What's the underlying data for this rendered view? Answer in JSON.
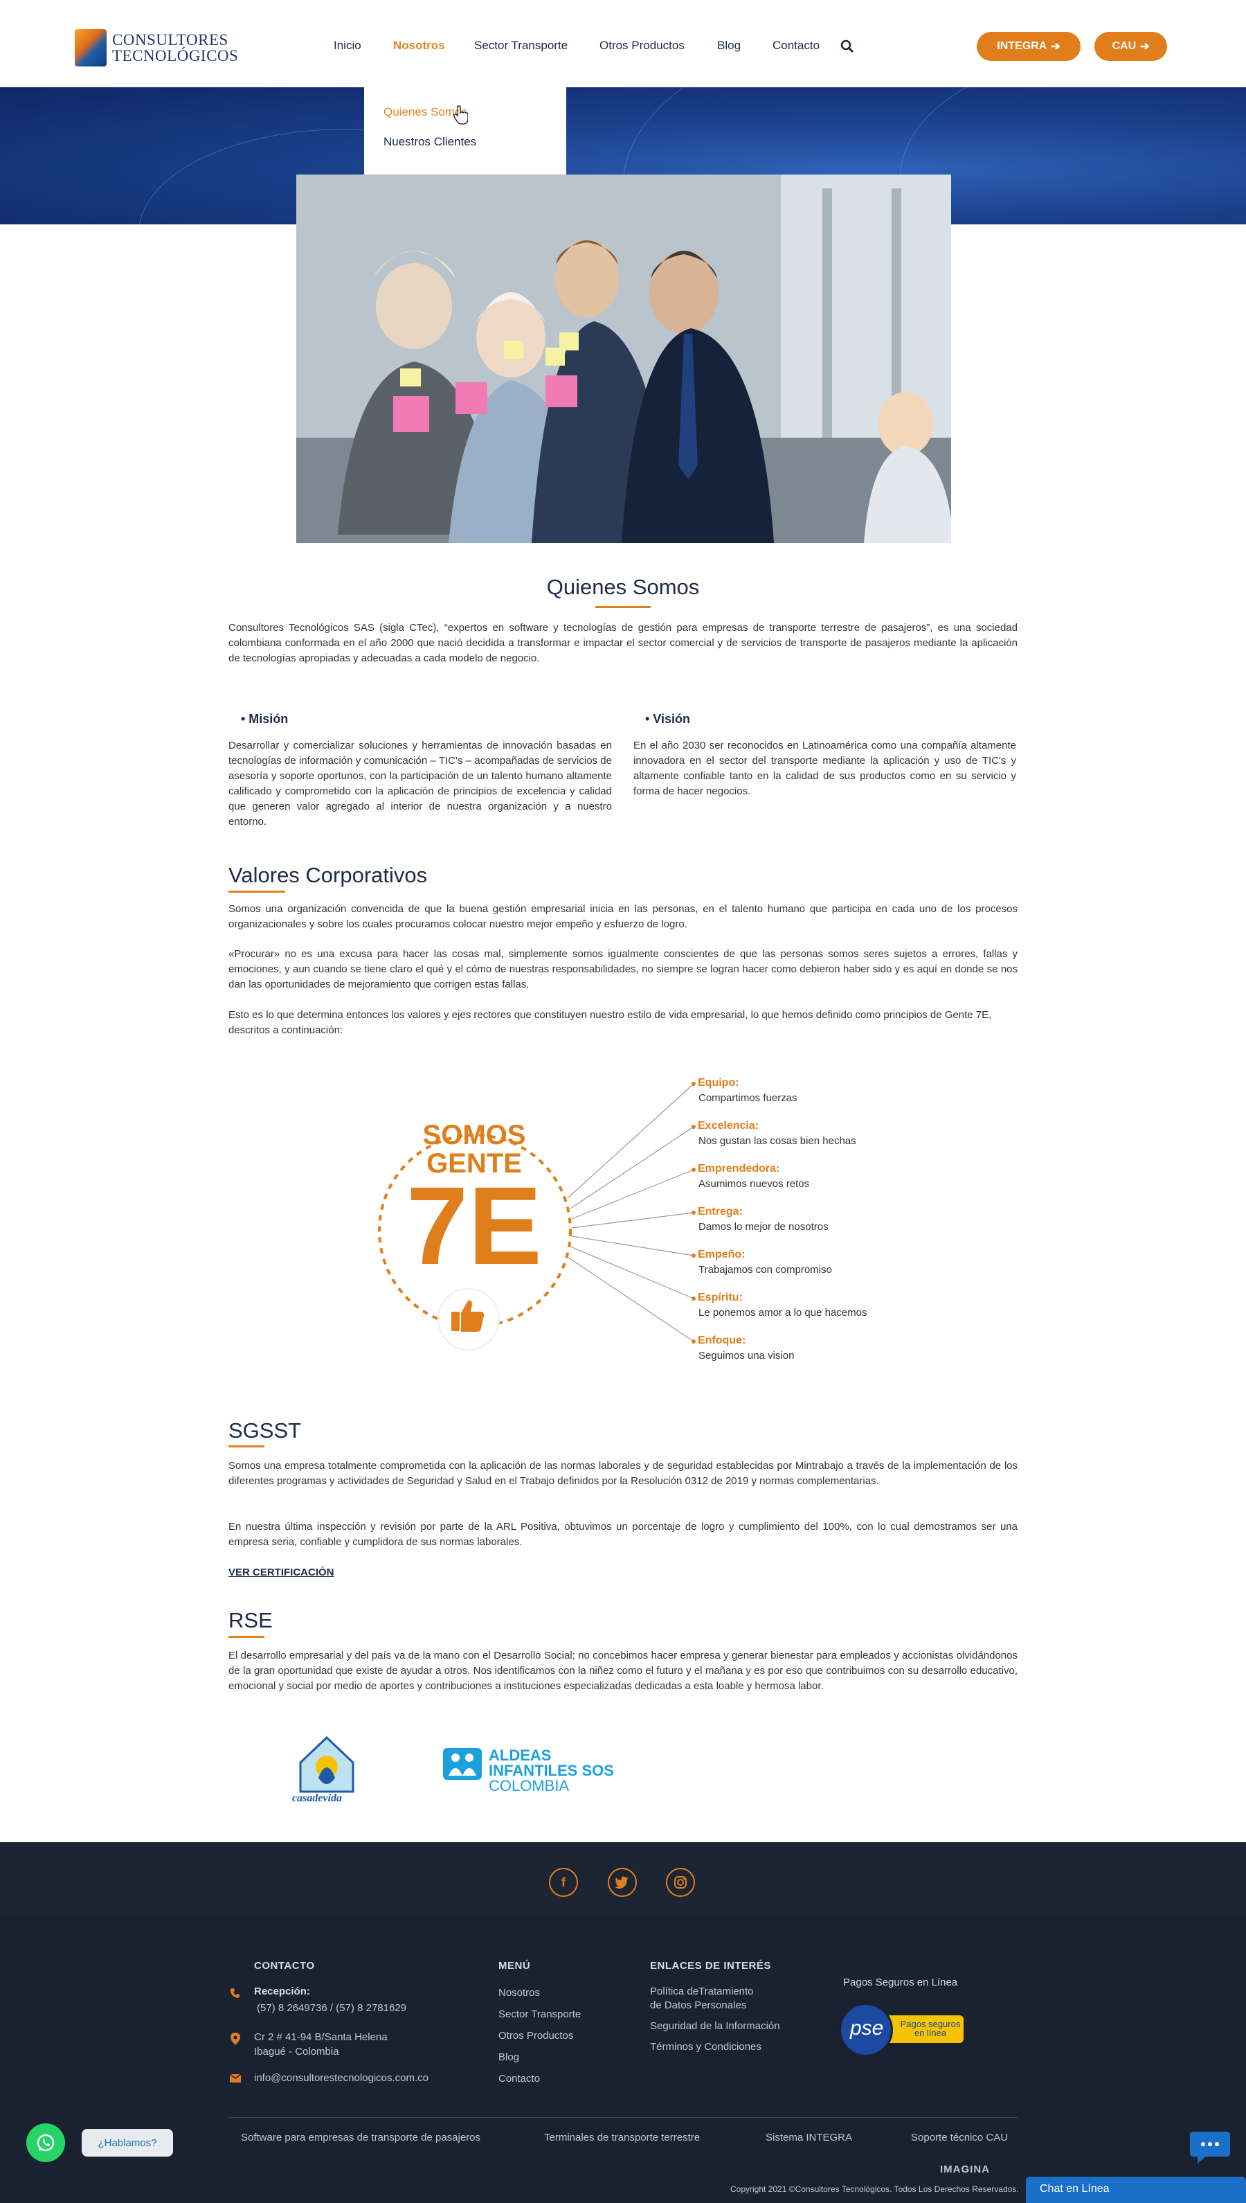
{
  "header": {
    "logo_line1": "CONSULTORES",
    "logo_line2": "TECNOLÓGICOS",
    "nav": [
      "Inicio",
      "Nosotros",
      "Sector Transporte",
      "Otros Productos",
      "Blog",
      "Contacto"
    ],
    "active_nav": "Nosotros",
    "btn_integra": "INTEGRA",
    "btn_cau": "CAU",
    "accent_color": "#df7e1b"
  },
  "dropdown": {
    "items": [
      "Quienes Somos",
      "Nuestros Clientes"
    ]
  },
  "about": {
    "title": "Quienes Somos",
    "intro": "Consultores Tecnológicos SAS (sigla CTec), “expertos en software y tecnologías de gestión para empresas de transporte terrestre de pasajeros”, es una sociedad colombiana conformada en el año 2000 que nació decidida a transformar e impactar el sector comercial y de servicios de transporte de pasajeros mediante la aplicación de tecnologías apropiadas y adecuadas a cada modelo de negocio.",
    "mision_title": "• Misión",
    "mision_text": "Desarrollar y comercializar soluciones y herramientas de innovación basadas en tecnologías de información y comunicación – TIC's – acompañadas de servicios de asesoría y soporte oportunos, con la participación de un talento humano altamente calificado y comprometido con la aplicación de principios de excelencia y calidad que generen valor agregado al interior de nuestra organización y a nuestro entorno.",
    "vision_title": "• Visión",
    "vision_text": "En el año 2030 ser reconocidos en Latinoamérica como una compañía altamente innovadora en el sector del transporte mediante la aplicación y uso de TIC's y altamente confiable tanto en la calidad de sus productos como en su servicio y forma de hacer negocios."
  },
  "valores": {
    "title": "Valores Corporativos",
    "p1": "Somos una organización convencida de que la buena gestión empresarial inicia en las personas, en el talento humano que participa en cada uno de los procesos organizacionales y sobre los cuales procuramos colocar nuestro mejor empeño y esfuerzo de logro.",
    "p2": "«Procurar» no es una excusa para hacer las cosas mal, simplemente somos igualmente conscientes de que las personas somos seres sujetos a errores, fallas y emociones, y aun cuando se tiene claro el qué y el cómo de nuestras responsabilidades, no siempre se logran hacer como debieron haber sido y es aquí en donde se nos dan las oportunidades de mejoramiento que corrigen estas fallas.",
    "p3": "Esto es lo que determina entonces los valores y ejes rectores que constituyen nuestro estilo de vida empresarial, lo que hemos definido como principios de Gente 7E, descritos a continuación:",
    "graphic_line1": "SOMOS",
    "graphic_line2": "GENTE",
    "graphic_big": "7E",
    "items": [
      {
        "name": "Equipo:",
        "desc": "Compartimos fuerzas"
      },
      {
        "name": "Excelencia:",
        "desc": "Nos gustan las cosas bien hechas"
      },
      {
        "name": "Emprendedora:",
        "desc": "Asumimos nuevos retos"
      },
      {
        "name": "Entrega:",
        "desc": "Damos lo mejor de nosotros"
      },
      {
        "name": "Empeño:",
        "desc": "Trabajamos con compromiso"
      },
      {
        "name": "Espíritu:",
        "desc": "Le ponemos amor a lo que hacemos"
      },
      {
        "name": "Enfoque:",
        "desc": "Seguimos una vision"
      }
    ]
  },
  "sgsst": {
    "title": "SGSST",
    "p1": "Somos una empresa totalmente comprometida con la aplicación de las normas laborales y de seguridad establecidas por Mintrabajo a través de la implementación de los diferentes programas y actividades de Seguridad y Salud en el Trabajo definidos por la Resolución 0312 de 2019 y normas complementarias.",
    "p2": "En nuestra última inspección y revisión por parte de la ARL Positiva, obtuvimos un porcentaje de logro y cumplimiento del 100%, con lo cual demostramos ser una empresa seria, confiable y cumplidora de sus normas laborales.",
    "link": "VER CERTIFICACIÓN"
  },
  "rse": {
    "title": "RSE",
    "p1": "El desarrollo empresarial y del país va de la mano con el Desarrollo Social; no concebimos hacer empresa y generar bienestar para empleados y accionistas olvidándonos de la gran oportunidad que existe de ayudar a otros. Nos identificamos con la niñez como el futuro y el mañana y es por eso que contribuimos con su desarrollo educativo, emocional y social por medio de aportes y contribuciones a instituciones especializadas dedicadas a esta loable y hermosa labor.",
    "logo1_text": "casadevida",
    "logo2_line1": "ALDEAS",
    "logo2_line2": "INFANTILES SOS",
    "logo2_line3": "COLOMBIA"
  },
  "footer": {
    "contact_head": "CONTACTO",
    "recepcion_label": "Recepción:",
    "phones": "(57) 8 2649736 / (57) 8 2781629",
    "address1": "Cr 2 # 41-94 B/Santa Helena",
    "address2": "Ibagué - Colombia",
    "email": "info@consultorestecnologicos.com.co",
    "menu_head": "MENÚ",
    "menu": [
      "Nosotros",
      "Sector Transporte",
      "Otros Productos",
      "Blog",
      "Contacto"
    ],
    "links_head": "ENLACES DE INTERÉS",
    "link1a": "Política deTratamiento",
    "link1b": "de Datos Personales",
    "link2": "Seguridad de la Información",
    "link3": "Términos y Condiciones",
    "pay_head": "Pagos Seguros en Línea",
    "pse_text": "pse",
    "pse_label1": "Pagos seguros",
    "pse_label2": "en línea",
    "bottom_links": [
      "Software para empresas de transporte de pasajeros",
      "Terminales de transporte terrestre",
      "Sistema INTEGRA",
      "Soporte técnico CAU"
    ],
    "imagina": "IMAGINA",
    "copyright": "Copyright 2021 ©Consultores Tecnológicos. Todos Los Derechos Reservados.",
    "whatsapp_label": "¿Hablamos?",
    "chat_label": "Chat en Línea"
  }
}
